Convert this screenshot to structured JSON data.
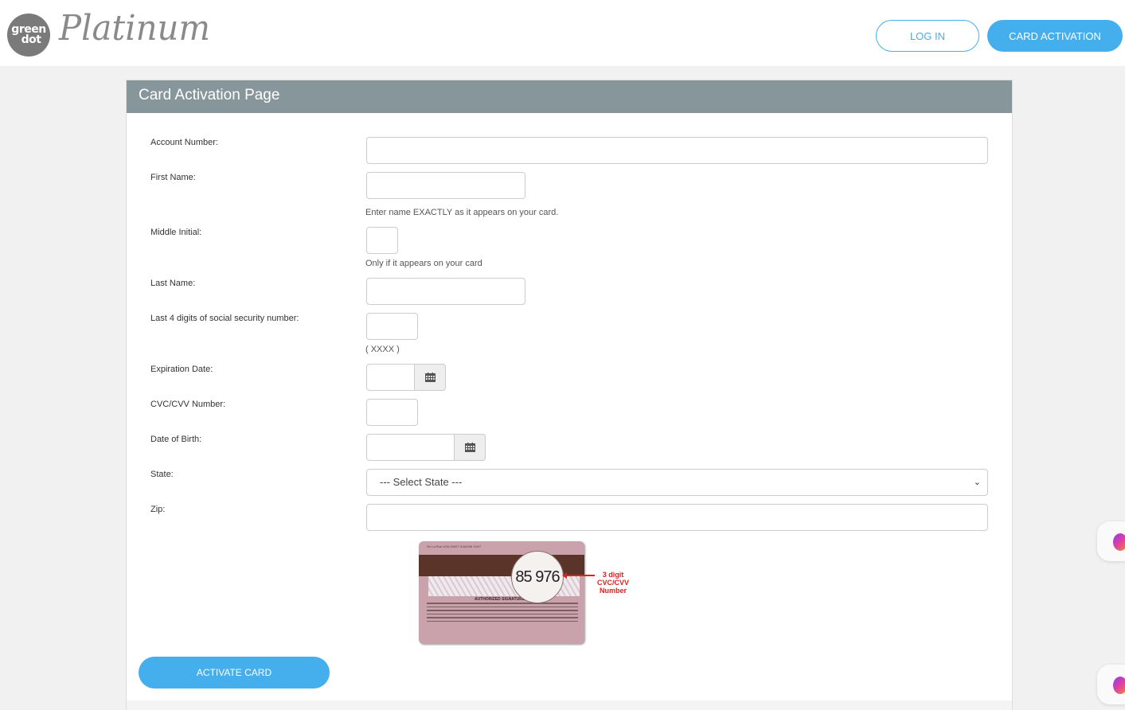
{
  "header": {
    "logo_circle_line1": "green",
    "logo_circle_line2": "dot",
    "logo_script": "Platinum",
    "login_label": "LOG IN",
    "card_activation_label": "CARD ACTIVATION"
  },
  "panel": {
    "title": "Card Activation Page"
  },
  "form": {
    "account_number": {
      "label": "Account Number:",
      "value": ""
    },
    "first_name": {
      "label": "First Name:",
      "value": "",
      "hint": "Enter name EXACTLY as it appears on your card."
    },
    "middle_initial": {
      "label": "Middle Initial:",
      "value": "",
      "hint": "Only if it appears on your card"
    },
    "last_name": {
      "label": "Last Name:",
      "value": ""
    },
    "ssn_last4": {
      "label": "Last 4 digits of social security number:",
      "value": "",
      "hint": "( XXXX )"
    },
    "expiration_date": {
      "label": "Expiration Date:",
      "value": ""
    },
    "cvc": {
      "label": "CVC/CVV Number:",
      "value": ""
    },
    "date_of_birth": {
      "label": "Date of Birth:",
      "value": ""
    },
    "state": {
      "label": "State:",
      "selected": "--- Select State ---"
    },
    "zip": {
      "label": "Zip:",
      "value": ""
    }
  },
  "card_illustration": {
    "magnified_number": "85 976",
    "small_print": "De La Rue USA 20007 ICA0206 10/07",
    "signature_heading": "AUTHORIZED SIGNATURE",
    "callout_line1": "3 digit",
    "callout_line2": "CVC/CVV",
    "callout_line3": "Number"
  },
  "activate_button_label": "ACTIVATE CARD",
  "colors": {
    "accent": "#45aeed",
    "panel_header": "#87969a",
    "callout": "#e02020"
  }
}
